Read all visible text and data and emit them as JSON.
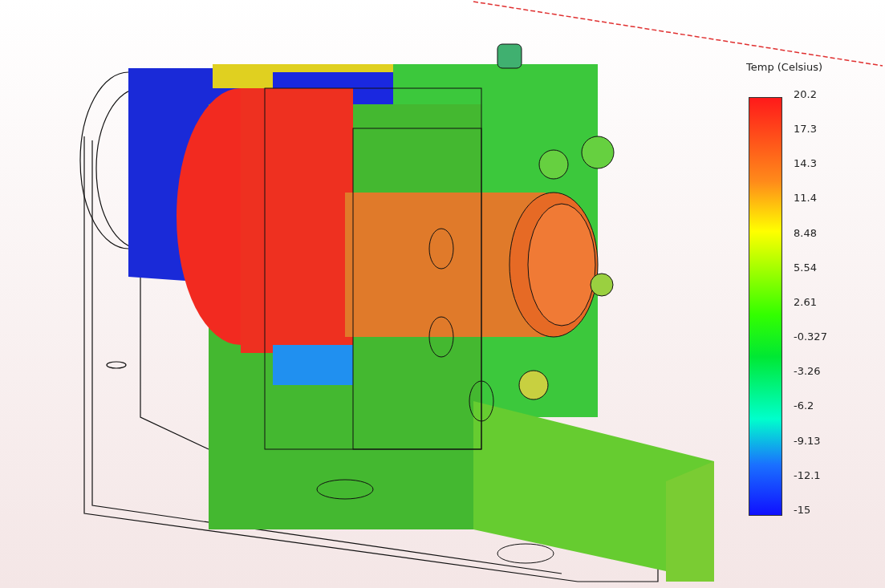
{
  "legend": {
    "title": "Temp (Celsius)",
    "labels": [
      "20.2",
      "17.3",
      "14.3",
      "11.4",
      "8.48",
      "5.54",
      "2.61",
      "-0.327",
      "-3.26",
      "-6.2",
      "-9.13",
      "-12.1",
      "-15"
    ]
  }
}
